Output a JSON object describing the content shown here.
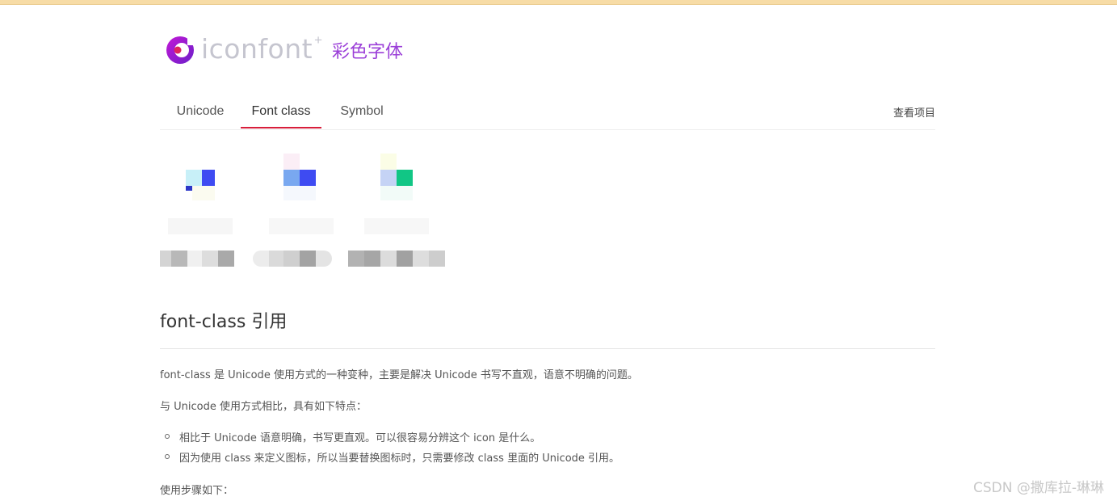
{
  "logo": {
    "word": "iconfont",
    "plus": "+",
    "subtitle": "彩色字体"
  },
  "tabs": [
    {
      "label": "Unicode"
    },
    {
      "label": "Font class"
    },
    {
      "label": "Symbol"
    }
  ],
  "view_project": "查看项目",
  "section": {
    "title": "font-class 引用",
    "intro": "font-class 是 Unicode 使用方式的一种变种，主要是解决 Unicode 书写不直观，语意不明确的问题。",
    "compare": "与 Unicode 使用方式相比，具有如下特点：",
    "bullets": [
      "相比于 Unicode 语意明确，书写更直观。可以很容易分辨这个 icon 是什么。",
      "因为使用 class 来定义图标，所以当要替换图标时，只需要修改 class 里面的 Unicode 引用。"
    ],
    "steps": "使用步骤如下："
  },
  "watermark": "CSDN @撒库拉-琳琳",
  "colors": {
    "accent_tab": "#d81e3a",
    "logo_purple": "#9b3fd8",
    "top_strip": "#f7dca6"
  }
}
